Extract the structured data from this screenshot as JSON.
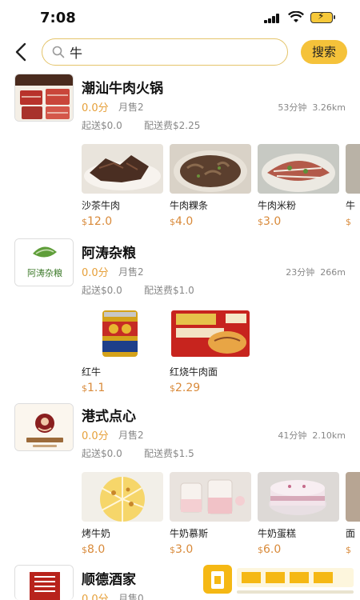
{
  "status": {
    "time": "7:08",
    "battery_text": "⚡"
  },
  "search": {
    "value": "牛",
    "button": "搜索"
  },
  "shops": [
    {
      "name": "潮汕牛肉火锅",
      "rating": "0.0分",
      "monthly": "月售2",
      "time": "53分钟",
      "distance": "3.26km",
      "min_order": "起送$0.0",
      "delivery_fee": "配送费$2.25",
      "products": [
        {
          "name": "沙茶牛肉",
          "cur": "$",
          "price": "12.0"
        },
        {
          "name": "牛肉粿条",
          "cur": "$",
          "price": "4.0"
        },
        {
          "name": "牛肉米粉",
          "cur": "$",
          "price": "3.0"
        },
        {
          "name": "牛",
          "cur": "$",
          "price": ""
        }
      ]
    },
    {
      "name": "阿涛杂粮",
      "logo_text": "阿涛杂粮",
      "rating": "0.0分",
      "monthly": "月售2",
      "time": "23分钟",
      "distance": "266m",
      "min_order": "起送$0.0",
      "delivery_fee": "配送费$1.0",
      "products": [
        {
          "name": "红牛",
          "cur": "$",
          "price": "1.1"
        },
        {
          "name": "红烧牛肉面",
          "cur": "$",
          "price": "2.29"
        }
      ]
    },
    {
      "name": "港式点心",
      "rating": "0.0分",
      "monthly": "月售2",
      "time": "41分钟",
      "distance": "2.10km",
      "min_order": "起送$0.0",
      "delivery_fee": "配送费$1.5",
      "products": [
        {
          "name": "烤牛奶",
          "cur": "$",
          "price": "8.0"
        },
        {
          "name": "牛奶慕斯",
          "cur": "$",
          "price": "3.0"
        },
        {
          "name": "牛奶蛋糕",
          "cur": "$",
          "price": "6.0"
        },
        {
          "name": "面",
          "cur": "$",
          "price": ""
        }
      ]
    },
    {
      "name": "顺德酒家",
      "rating": "0.0分",
      "monthly": "月售0"
    }
  ],
  "colors": {
    "accent": "#f5c23a",
    "price": "#d98a3a",
    "rating": "#e6a03a",
    "muted": "#888888"
  }
}
